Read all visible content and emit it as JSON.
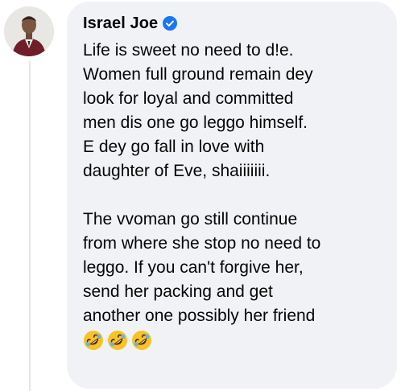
{
  "comment": {
    "author": "Israel Joe",
    "verified_icon": "verified-badge-icon",
    "paragraph1_lines": [
      "Life is sweet no need to d!e.",
      "Women full ground remain dey",
      "look for loyal and committed",
      "men dis one go leggo himself.",
      "E dey go fall in love with",
      "daughter of Eve, shaiiiiiii."
    ],
    "paragraph2_lines": [
      "The vvoman go still continue",
      "from where she stop no need to",
      "leggo. If you can't forgive her,",
      "send her packing and get",
      "another one possibly her friend"
    ],
    "emojis": [
      "rolling-on-floor-laughing-emoji",
      "rolling-on-floor-laughing-emoji",
      "rolling-on-floor-laughing-emoji"
    ]
  },
  "colors": {
    "bubble_bg": "#f0f2f5",
    "text": "#050505",
    "verified_blue": "#1877f2",
    "thread_line": "#e4e6eb"
  }
}
